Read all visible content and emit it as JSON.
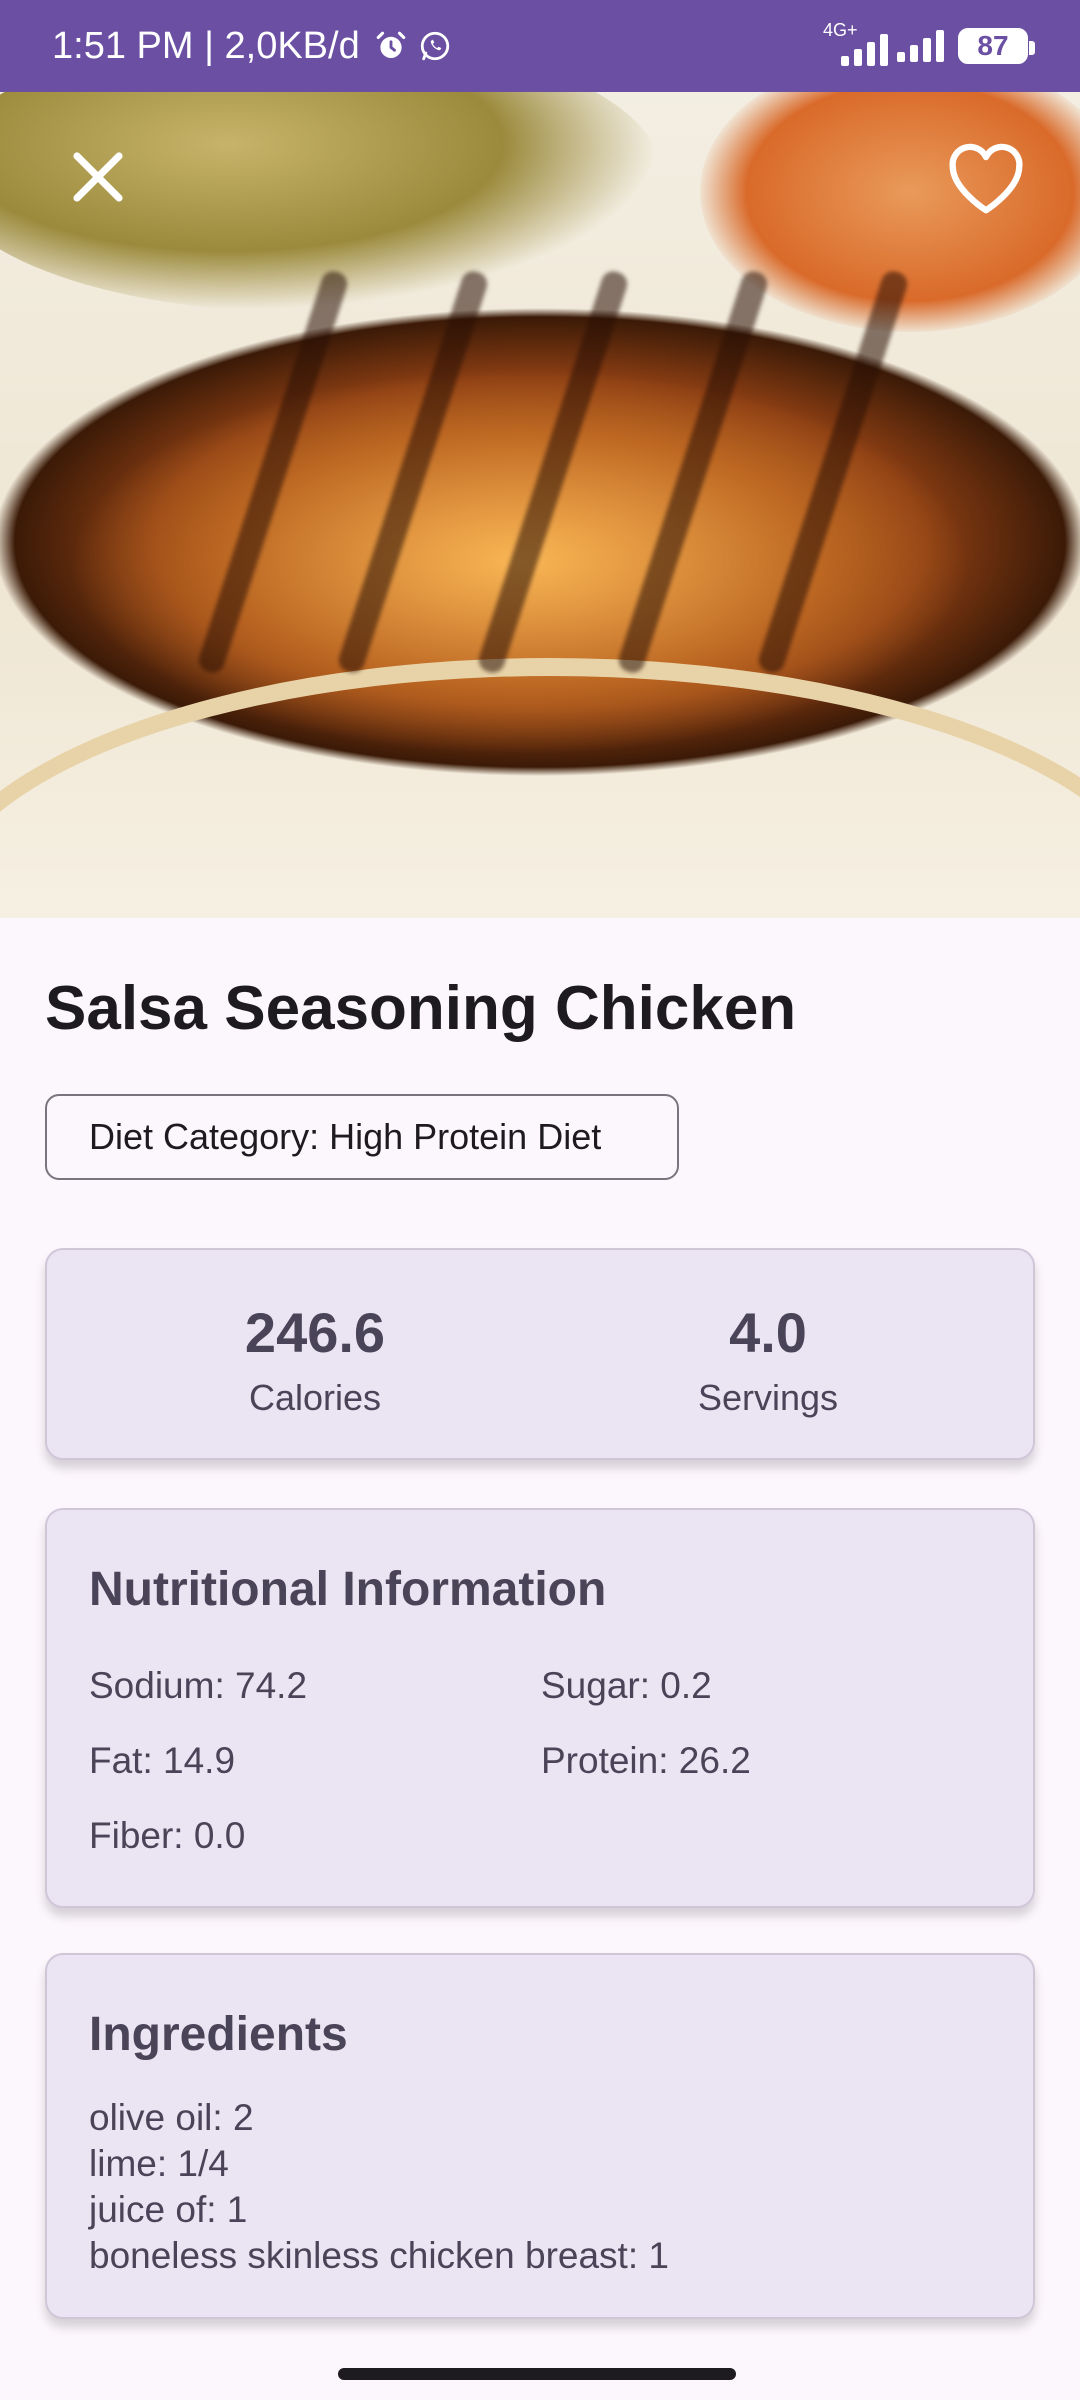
{
  "status_bar": {
    "time_data": "1:51 PM | 2,0KB/d",
    "network": "4G+",
    "battery": "87"
  },
  "recipe": {
    "title": "Salsa Seasoning Chicken",
    "diet_category": "Diet Category: High Protein Diet"
  },
  "stats": {
    "calories_value": "246.6",
    "calories_label": "Calories",
    "servings_value": "4.0",
    "servings_label": "Servings"
  },
  "nutrition": {
    "heading": "Nutritional Information",
    "sodium": "Sodium: 74.2",
    "sugar": "Sugar: 0.2",
    "fat": "Fat: 14.9",
    "protein": "Protein: 26.2",
    "fiber": "Fiber: 0.0"
  },
  "ingredients": {
    "heading": "Ingredients",
    "items": [
      "olive oil: 2",
      "lime: 1/4",
      "juice of: 1",
      "boneless skinless chicken breast: 1"
    ]
  },
  "icons": {
    "close": "close-icon",
    "favorite": "heart-outline-icon",
    "alarm": "alarm-icon",
    "whatsapp": "whatsapp-icon"
  },
  "colors": {
    "status_bar": "#6a4fa3",
    "card_bg": "#ebe4f2",
    "page_bg": "#fcf7fd"
  }
}
